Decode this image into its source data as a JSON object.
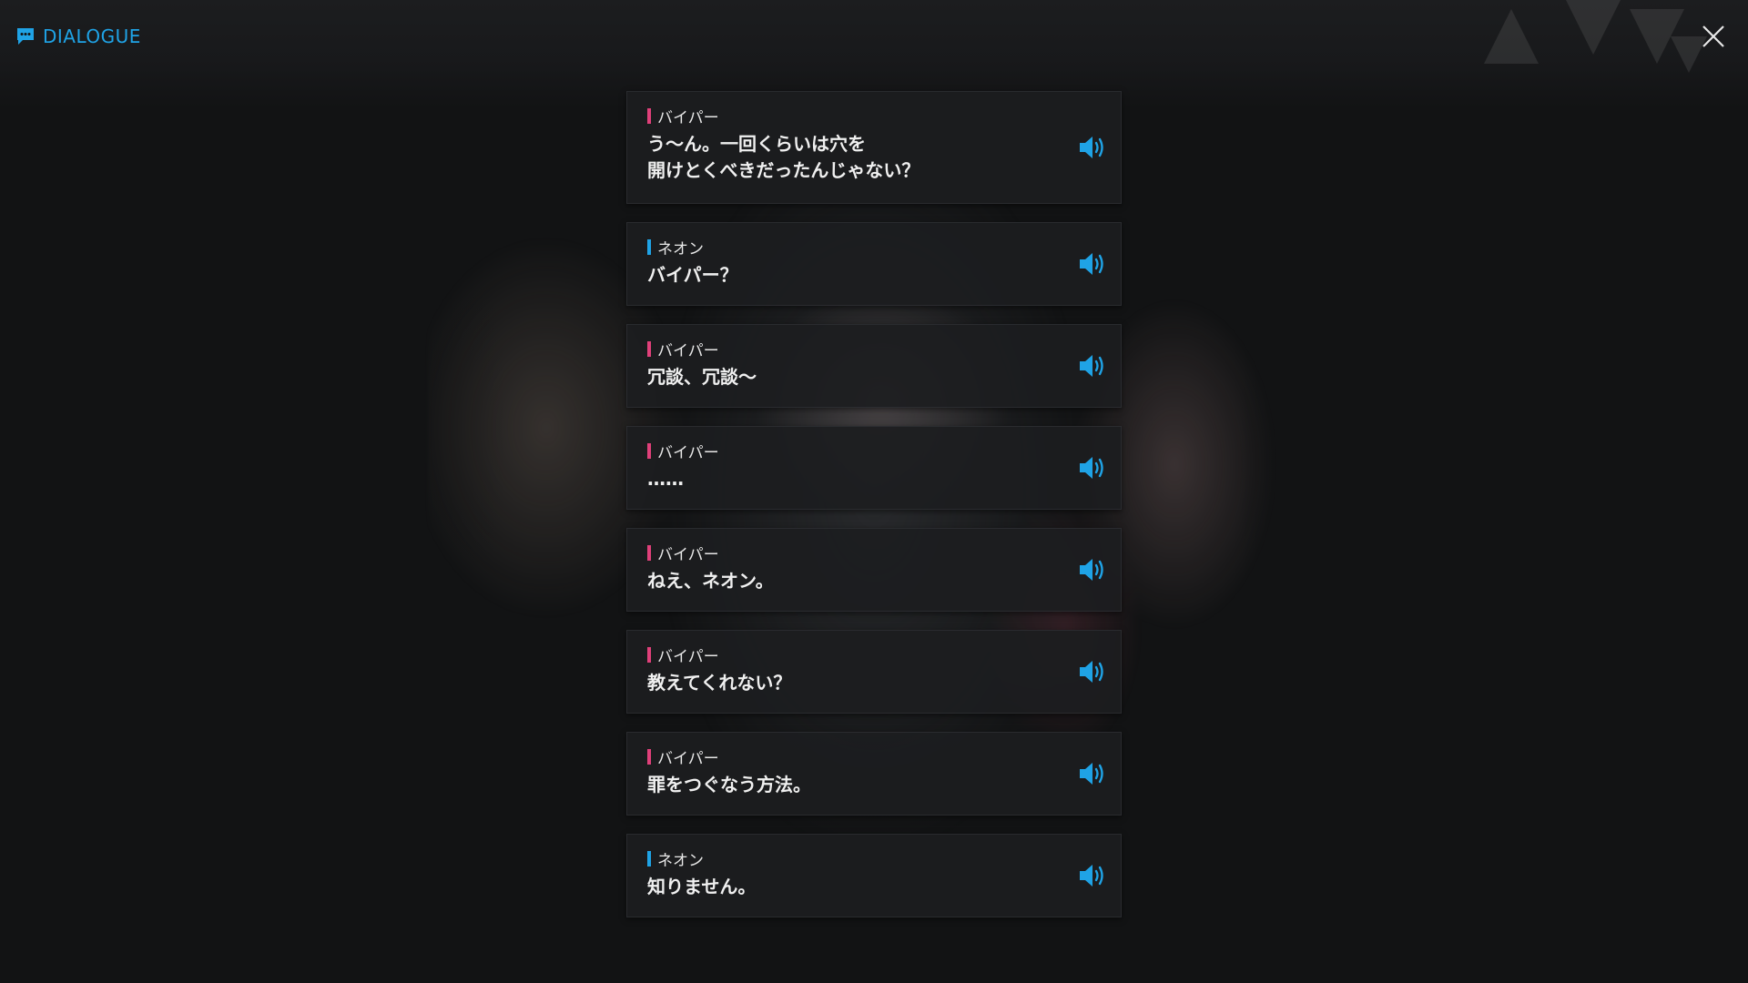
{
  "header": {
    "title": "DIALOGUE",
    "icon": "chat-bubble-icon",
    "close_icon": "close-icon"
  },
  "colors": {
    "accent": "#1fa3e6",
    "piper": "#e0407a",
    "neon": "#1fa3e6"
  },
  "dialogue": [
    {
      "speaker": "バイパー",
      "speaker_color": "piper",
      "text": "う～ん。一回くらいは穴を\n開けとくべきだったんじゃない？"
    },
    {
      "speaker": "ネオン",
      "speaker_color": "neon",
      "text": "バイパー？"
    },
    {
      "speaker": "バイパー",
      "speaker_color": "piper",
      "text": "冗談、冗談～"
    },
    {
      "speaker": "バイパー",
      "speaker_color": "piper",
      "text": "……"
    },
    {
      "speaker": "バイパー",
      "speaker_color": "piper",
      "text": "ねえ、ネオン。"
    },
    {
      "speaker": "バイパー",
      "speaker_color": "piper",
      "text": "教えてくれない？"
    },
    {
      "speaker": "バイパー",
      "speaker_color": "piper",
      "text": "罪をつぐなう方法。"
    },
    {
      "speaker": "ネオン",
      "speaker_color": "neon",
      "text": "知りません。"
    }
  ]
}
